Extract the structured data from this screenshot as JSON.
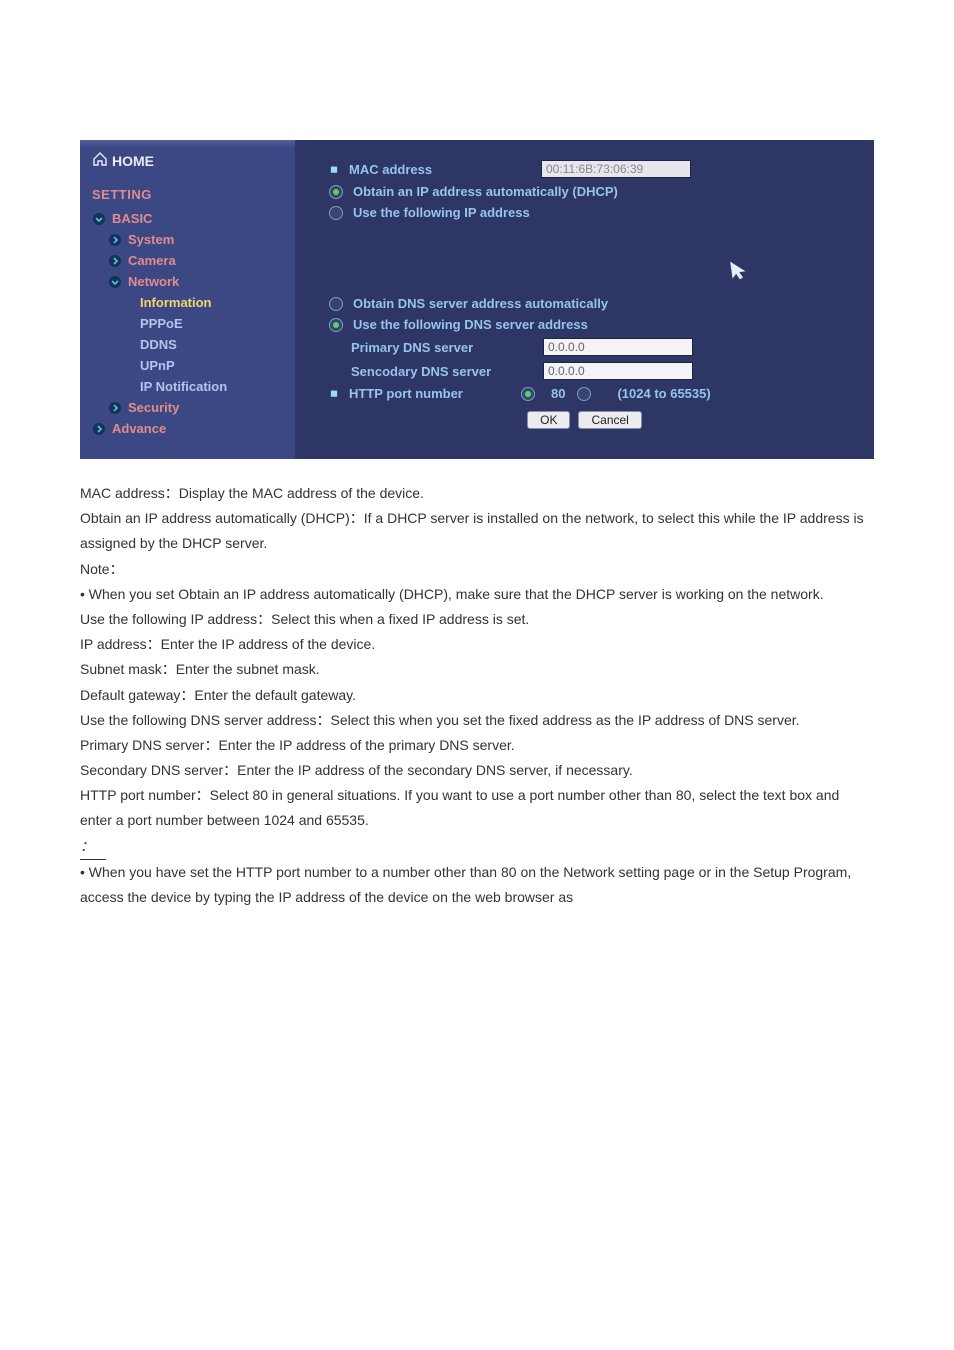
{
  "sidebar": {
    "home": "HOME",
    "setting": "SETTING",
    "basic": "BASIC",
    "items": [
      "System",
      "Camera",
      "Network"
    ],
    "network_children": [
      "Information",
      "PPPoE",
      "DDNS",
      "UPnP",
      "IP Notification"
    ],
    "security": "Security",
    "advance": "Advance"
  },
  "panel": {
    "mac_label": "MAC address",
    "mac_value": "00:11:6B:73:06:39",
    "opt_dhcp": "Obtain an IP address automatically (DHCP)",
    "opt_static": "Use the following IP address",
    "opt_dns_auto": "Obtain DNS server address automatically",
    "opt_dns_static": "Use the following DNS server address",
    "primary_dns_label": "Primary DNS server",
    "primary_dns_value": "0.0.0.0",
    "secondary_dns_label": "Sencodary DNS server",
    "secondary_dns_value": "0.0.0.0",
    "http_port_label": "HTTP port number",
    "http_port_default": "80",
    "http_port_hint": "(1024 to 65535)",
    "ok": "OK",
    "cancel": "Cancel"
  },
  "desc": {
    "l1": "MAC address：Display the MAC address of the device.",
    "l2": "Obtain an IP address automatically (DHCP)：If a DHCP server is installed on the network, to select this while the IP address is assigned by the DHCP server.",
    "l3": "Note：",
    "l4": "• When you set Obtain an IP address automatically (DHCP), make sure that the DHCP server is working on the network.",
    "l5": "Use the following IP address：Select this when a fixed IP address is set.",
    "l6": "IP address：Enter the IP address of the device.",
    "l7": "Subnet mask：Enter the subnet mask.",
    "l8": "Default gateway：Enter the default gateway.",
    "l9": "Use the following DNS server address：Select this when you set the fixed address as the IP address of DNS server.",
    "l10": "Primary DNS server：Enter the IP address of the primary DNS server.",
    "l11": "Secondary DNS server：Enter the IP address of the secondary DNS server, if necessary.",
    "l12": "HTTP port number：Select 80 in general situations. If you want to use a port number other than 80, select the text box and enter a port number between 1024 and 65535.",
    "l13": "：",
    "l14": "• When you have set the HTTP port number to a number other than 80 on the Network setting page or in the Setup Program, access the device by typing the IP address of the device on the web browser as"
  }
}
